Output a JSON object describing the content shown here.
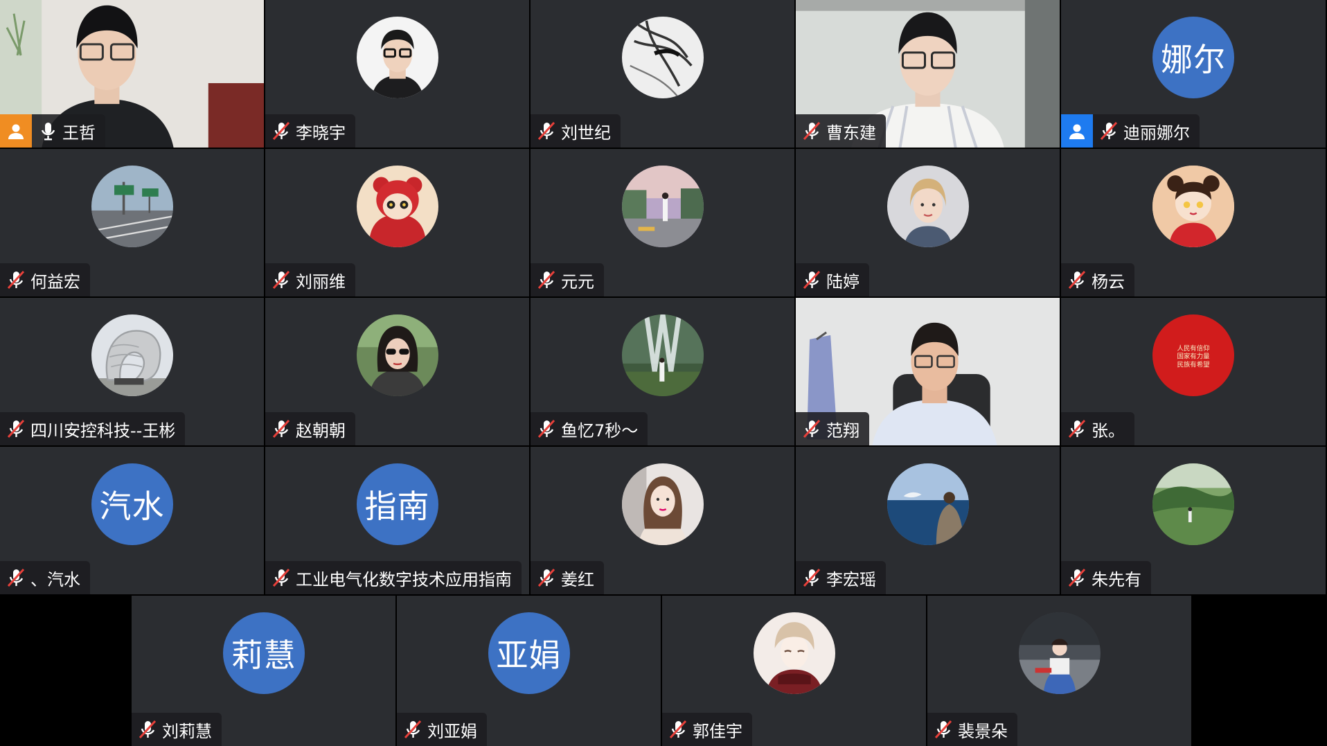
{
  "meeting": {
    "participants": [
      {
        "name": "王哲",
        "kind": "video",
        "mic": "on",
        "host": true,
        "host_color": "#f08d22",
        "scene": "man-room"
      },
      {
        "name": "李晓宇",
        "kind": "photo",
        "mic": "muted",
        "photo": "man-glasses"
      },
      {
        "name": "刘世纪",
        "kind": "photo",
        "mic": "muted",
        "photo": "sketch"
      },
      {
        "name": "曹东建",
        "kind": "video",
        "mic": "muted",
        "scene": "man-office"
      },
      {
        "name": "迪丽娜尔",
        "kind": "text",
        "mic": "muted",
        "avatar_text": "娜尔",
        "host": true,
        "host_color": "#1e7bf0"
      },
      {
        "name": "何益宏",
        "kind": "photo",
        "mic": "muted",
        "photo": "road"
      },
      {
        "name": "刘丽维",
        "kind": "photo",
        "mic": "muted",
        "photo": "cartoon-red"
      },
      {
        "name": "元元",
        "kind": "photo",
        "mic": "muted",
        "photo": "street"
      },
      {
        "name": "陆婷",
        "kind": "photo",
        "mic": "muted",
        "photo": "woman"
      },
      {
        "name": "杨云",
        "kind": "photo",
        "mic": "muted",
        "photo": "cartoon-girl"
      },
      {
        "name": "四川安控科技--王彬",
        "kind": "photo",
        "mic": "muted",
        "photo": "sculpture"
      },
      {
        "name": "赵朝朝",
        "kind": "photo",
        "mic": "muted",
        "photo": "woman-sunglasses"
      },
      {
        "name": "鱼忆7秒～",
        "kind": "photo",
        "mic": "muted",
        "photo": "waterfall"
      },
      {
        "name": "范翔",
        "kind": "video",
        "mic": "muted",
        "scene": "man-chair"
      },
      {
        "name": "张。",
        "kind": "photo",
        "mic": "muted",
        "photo": "red-seal",
        "photo_lines": [
          "人民有信仰",
          "国家有力量",
          "民族有希望"
        ]
      },
      {
        "name": "、汽水",
        "kind": "text",
        "mic": "muted",
        "avatar_text": "汽水"
      },
      {
        "name": "工业电气化数字技术应用指南",
        "kind": "text",
        "mic": "muted",
        "avatar_text": "指南"
      },
      {
        "name": "姜红",
        "kind": "photo",
        "mic": "muted",
        "photo": "woman-car"
      },
      {
        "name": "李宏瑶",
        "kind": "photo",
        "mic": "muted",
        "photo": "sea"
      },
      {
        "name": "朱先有",
        "kind": "photo",
        "mic": "muted",
        "photo": "forest"
      },
      {
        "name": "刘莉慧",
        "kind": "text",
        "mic": "muted",
        "avatar_text": "莉慧"
      },
      {
        "name": "刘亚娟",
        "kind": "text",
        "mic": "muted",
        "avatar_text": "亚娟"
      },
      {
        "name": "郭佳宇",
        "kind": "photo",
        "mic": "muted",
        "photo": "anime-boy"
      },
      {
        "name": "裴景朵",
        "kind": "photo",
        "mic": "muted",
        "photo": "car-girl"
      }
    ]
  }
}
